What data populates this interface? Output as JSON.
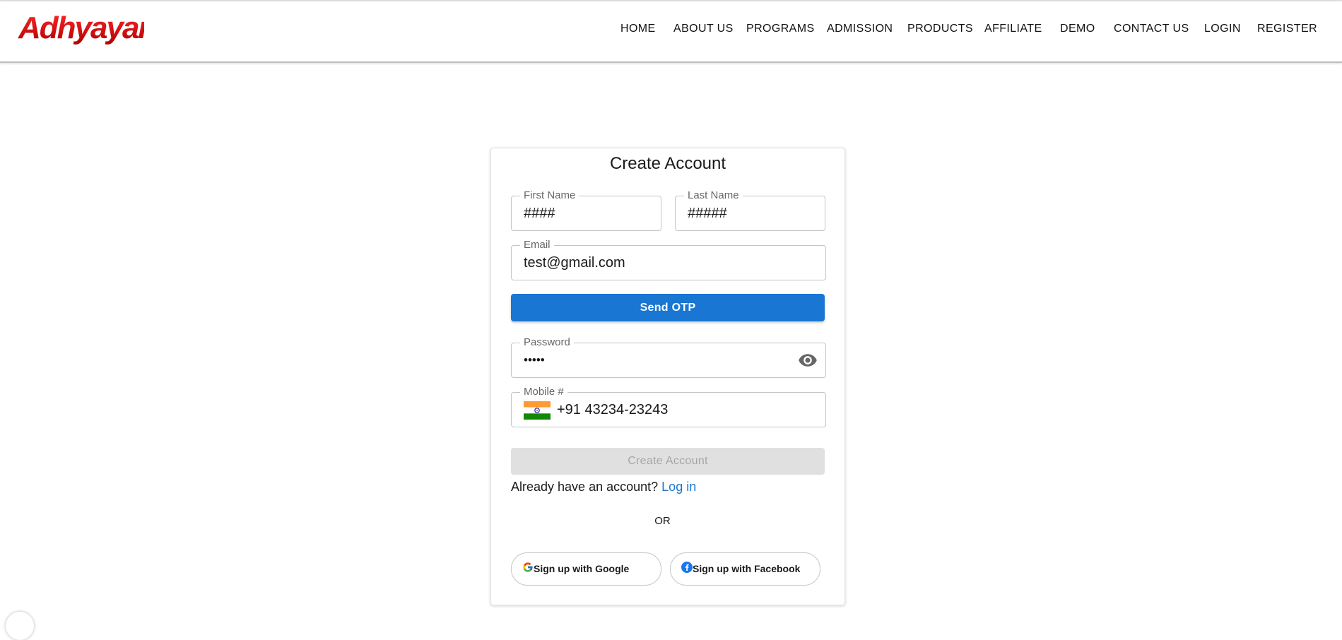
{
  "brand": {
    "logo_text": "Adhyayan",
    "logo_color": "#d40f12"
  },
  "nav": {
    "items": [
      "HOME",
      "ABOUT US",
      "PROGRAMS",
      "ADMISSION",
      "PRODUCTS",
      "AFFILIATE",
      "DEMO",
      "CONTACT US",
      "LOGIN",
      "REGISTER"
    ]
  },
  "form": {
    "title": "Create Account",
    "first_name": {
      "label": "First Name",
      "value": "####"
    },
    "last_name": {
      "label": "Last Name",
      "value": "#####"
    },
    "email": {
      "label": "Email",
      "value": "test@gmail.com"
    },
    "send_otp_label": "Send OTP",
    "password": {
      "label": "Password",
      "value": "•••••",
      "toggle_icon": "eye-icon"
    },
    "mobile": {
      "label": "Mobile #",
      "value": "+91 43234-23243",
      "country_flag": "india-flag-icon"
    },
    "submit_label": "Create Account",
    "already_text": "Already have an account?",
    "login_link": "Log in",
    "or_text": "OR",
    "google_label": "Sign up with Google",
    "facebook_label": "Sign up with Facebook"
  },
  "colors": {
    "primary": "#1976d2",
    "disabled_bg": "#e0e0e0",
    "disabled_text": "#a6a6a6",
    "logo_red": "#d40f12"
  }
}
